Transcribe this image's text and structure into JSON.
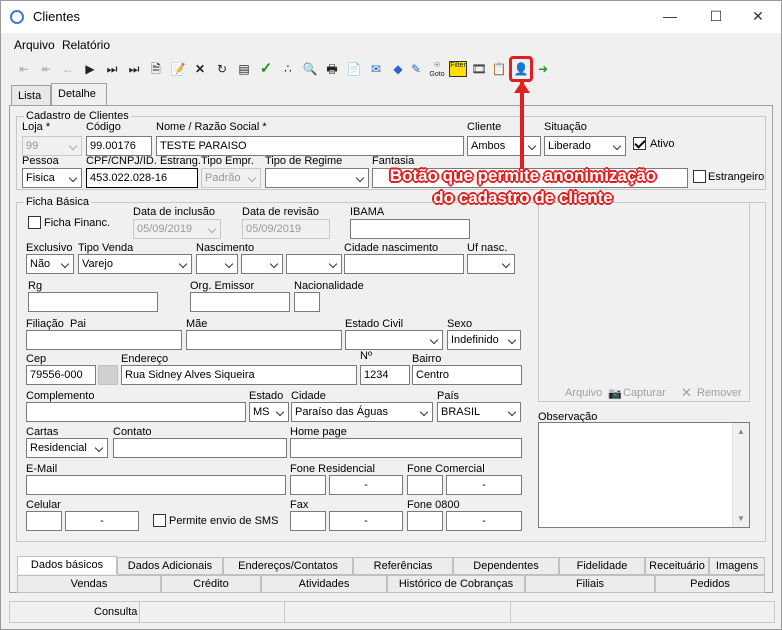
{
  "window": {
    "title": "Clientes"
  },
  "menu": {
    "arquivo": "Arquivo",
    "relatorio": "Relatório"
  },
  "toolbar": {
    "goto_label": "Goto",
    "filter_label": "Filter"
  },
  "tabs_top": {
    "lista": "Lista",
    "detalhe": "Detalhe"
  },
  "cadastro": {
    "group_title": "Cadastro de Clientes",
    "loja_label": "Loja *",
    "loja_value": "99",
    "codigo_label": "Código",
    "codigo_value": "99.00176",
    "nome_label": "Nome / Razão Social *",
    "nome_value": "TESTE PARAISO",
    "cliente_label": "Cliente",
    "cliente_value": "Ambos",
    "situacao_label": "Situação",
    "situacao_value": "Liberado",
    "ativo_label": "Ativo",
    "pessoa_label": "Pessoa",
    "pessoa_value": "Fisica",
    "cpf_label": "CPF/CNPJ/ID. Estrang.",
    "cpf_value": "453.022.028-16",
    "tipo_empr_label": "Tipo Empr.",
    "tipo_empr_value": "Padrão",
    "tipo_regime_label": "Tipo de Regime",
    "fantasia_label": "Fantasia",
    "estrangeiro_label": "Estrangeiro"
  },
  "ficha": {
    "group_title": "Ficha Básica",
    "ficha_financ_label": "Ficha Financ.",
    "data_inclusao_label": "Data de inclusão",
    "data_inclusao_value": "05/09/2019",
    "data_revisao_label": "Data de revisão",
    "data_revisao_value": "05/09/2019",
    "ibama_label": "IBAMA",
    "exclusivo_label": "Exclusivo",
    "exclusivo_value": "Não",
    "tipo_venda_label": "Tipo Venda",
    "tipo_venda_value": "Varejo",
    "nascimento_label": "Nascimento",
    "cidade_nasc_label": "Cidade nascimento",
    "uf_nasc_label": "Uf nasc.",
    "rg_label": "Rg",
    "org_emissor_label": "Org. Emissor",
    "nacionalidade_label": "Nacionalidade",
    "filiacao_label": "Filiação",
    "pai_label": "Pai",
    "mae_label": "Mãe",
    "estado_civil_label": "Estado Civil",
    "sexo_label": "Sexo",
    "sexo_value": "Indefinido",
    "cep_label": "Cep",
    "cep_value": "79556-000",
    "endereco_label": "Endereço",
    "endereco_value": "Rua Sidney Alves Siqueira",
    "numero_label": "Nº",
    "numero_value": "1234",
    "bairro_label": "Bairro",
    "bairro_value": "Centro",
    "complemento_label": "Complemento",
    "estado_label": "Estado",
    "estado_value": "MS",
    "cidade_label": "Cidade",
    "cidade_value": "Paraíso das Águas",
    "pais_label": "País",
    "pais_value": "BRASIL",
    "cartas_label": "Cartas",
    "cartas_value": "Residencial",
    "contato_label": "Contato",
    "home_page_label": "Home page",
    "email_label": "E-Mail",
    "fone_res_label": "Fone Residencial",
    "fone_com_label": "Fone Comercial",
    "celular_label": "Celular",
    "sms_label": "Permite envio de SMS",
    "fax_label": "Fax",
    "fone0800_label": "Fone 0800",
    "dash": "-"
  },
  "photo": {
    "arquivo": "Arquivo",
    "capturar": "Capturar",
    "remover": "Remover"
  },
  "observacao_label": "Observação",
  "annotation": {
    "line1": "Botão que permite anonimização",
    "line2": "do cadastro de cliente"
  },
  "tabs_bottom_row1": [
    "Dados básicos",
    "Dados Adicionais",
    "Endereços/Contatos",
    "Referências",
    "Dependentes",
    "Fidelidade",
    "Receituário",
    "Imagens"
  ],
  "tabs_bottom_row2": [
    "Vendas",
    "Crédito",
    "Atividades",
    "Histórico de Cobranças",
    "Filiais",
    "Pedidos"
  ],
  "status": {
    "consulta": "Consulta"
  }
}
